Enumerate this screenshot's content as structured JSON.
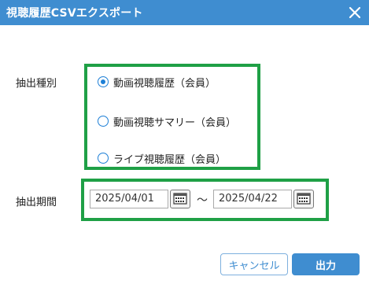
{
  "dialog": {
    "title": "視聴履歴CSVエクスポート"
  },
  "form": {
    "type_label": "抽出種別",
    "type_options": [
      {
        "label": "動画視聴履歴（会員）",
        "selected": true
      },
      {
        "label": "動画視聴サマリー（会員）",
        "selected": false
      },
      {
        "label": "ライブ視聴履歴（会員）",
        "selected": false
      }
    ],
    "period_label": "抽出期間",
    "start_date": "2025/04/01",
    "end_date": "2025/04/22",
    "range_separator": "～"
  },
  "buttons": {
    "cancel_label": "キャンセル",
    "submit_label": "出力"
  },
  "colors": {
    "header": "#3f8dd0",
    "highlight_border": "#1fa046",
    "radio": "#1d7fd6"
  }
}
